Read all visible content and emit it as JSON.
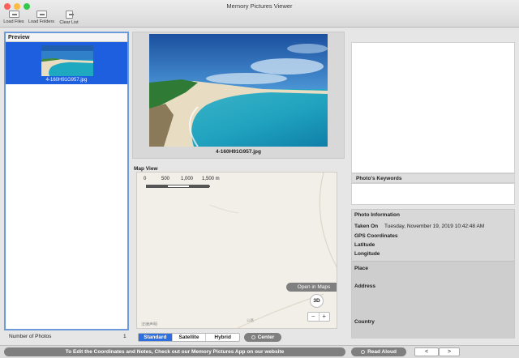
{
  "window": {
    "title": "Memory Pictures Viewer"
  },
  "toolbar": {
    "load_files": "Load Files",
    "load_folders": "Load Folders",
    "clear_list": "Clear List"
  },
  "sidebar": {
    "header": "Preview",
    "items": [
      {
        "filename": "4-160H91G957.jpg",
        "selected": true
      }
    ],
    "count_label": "Number of Photos",
    "count_value": "1"
  },
  "photo": {
    "caption": "4-160H91G957.jpg"
  },
  "map": {
    "title": "Map View",
    "scale": {
      "labels": [
        "0",
        "500",
        "1,000",
        "1,500 m"
      ]
    },
    "open_in_maps": "Open in Maps",
    "three_d": "3D",
    "zoom_out": "−",
    "zoom_in": "+",
    "legal": "法律声明",
    "road": "公路",
    "modes": [
      "Standard",
      "Satellite",
      "Hybrid"
    ],
    "active_mode": "Standard",
    "center": "Center"
  },
  "keywords": {
    "header": "Photo's Keywords"
  },
  "info": {
    "header": "Photo Information",
    "taken_on_label": "Taken On",
    "taken_on_value": "Tuesday, November 19, 2019 10:42:48 AM",
    "gps_label": "GPS Coordinates",
    "latitude_label": "Latitude",
    "longitude_label": "Longitude",
    "place_label": "Place",
    "address_label": "Address",
    "country_label": "Country"
  },
  "footer": {
    "promo": "To Edit the Coordinates and Notes, Check out our Memory Pictures App on our website",
    "read_aloud": "Read Aloud",
    "prev": "<",
    "next": ">"
  },
  "colors": {
    "accent": "#2e6fe0",
    "selection": "#1e5fe0",
    "button_gray": "#7f7f7f"
  }
}
